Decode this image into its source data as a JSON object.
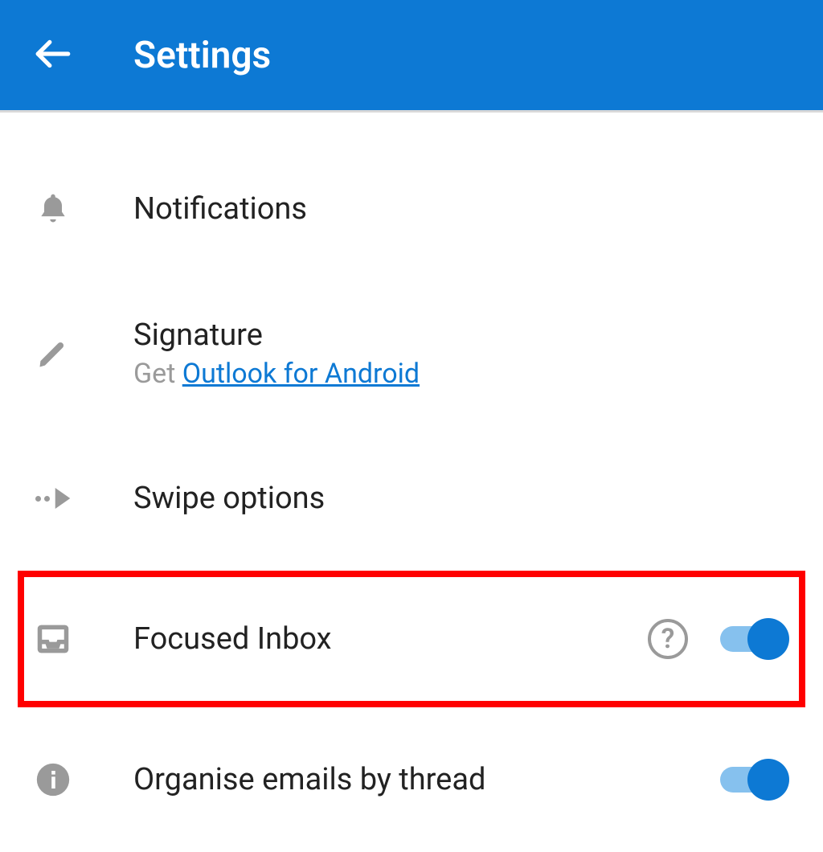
{
  "header": {
    "title": "Settings"
  },
  "items": {
    "notifications": {
      "label": "Notifications"
    },
    "signature": {
      "label": "Signature",
      "sub_prefix": "Get ",
      "sub_link": "Outlook for Android"
    },
    "swipe": {
      "label": "Swipe options"
    },
    "focused": {
      "label": "Focused Inbox",
      "help_text": "?",
      "toggle_on": true,
      "highlighted": true
    },
    "thread": {
      "label": "Organise emails by thread",
      "toggle_on": true
    }
  },
  "colors": {
    "primary": "#0d79d4",
    "icon_grey": "#9a9a9a",
    "highlight": "#ff0000"
  }
}
